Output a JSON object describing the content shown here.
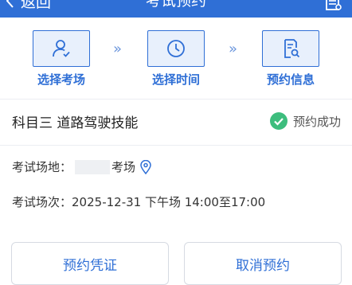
{
  "header": {
    "back_label": "返回",
    "title": "考试预约",
    "icon": "receipt-icon"
  },
  "steps": [
    {
      "label": "选择考场",
      "icon": "person-check-icon"
    },
    {
      "label": "选择时间",
      "icon": "clock-icon"
    },
    {
      "label": "预约信息",
      "icon": "document-search-icon"
    }
  ],
  "step_arrow": "»",
  "subject": {
    "title": "科目三 道路驾驶技能",
    "status_text": "预约成功",
    "status_icon": "check-circle-icon"
  },
  "details": {
    "venue_label": "考试场地：",
    "venue_suffix": "考场",
    "venue_icon": "location-pin-icon",
    "session_label": "考试场次：",
    "session_value": "2025-12-31 下午场 14:00至17:00"
  },
  "buttons": {
    "voucher_label": "预约凭证",
    "cancel_label": "取消预约"
  },
  "colors": {
    "primary": "#2f6fd6",
    "step_bg": "#e8f0fc",
    "success": "#3dbd7d",
    "text": "#222222",
    "divider": "#eceef2"
  }
}
